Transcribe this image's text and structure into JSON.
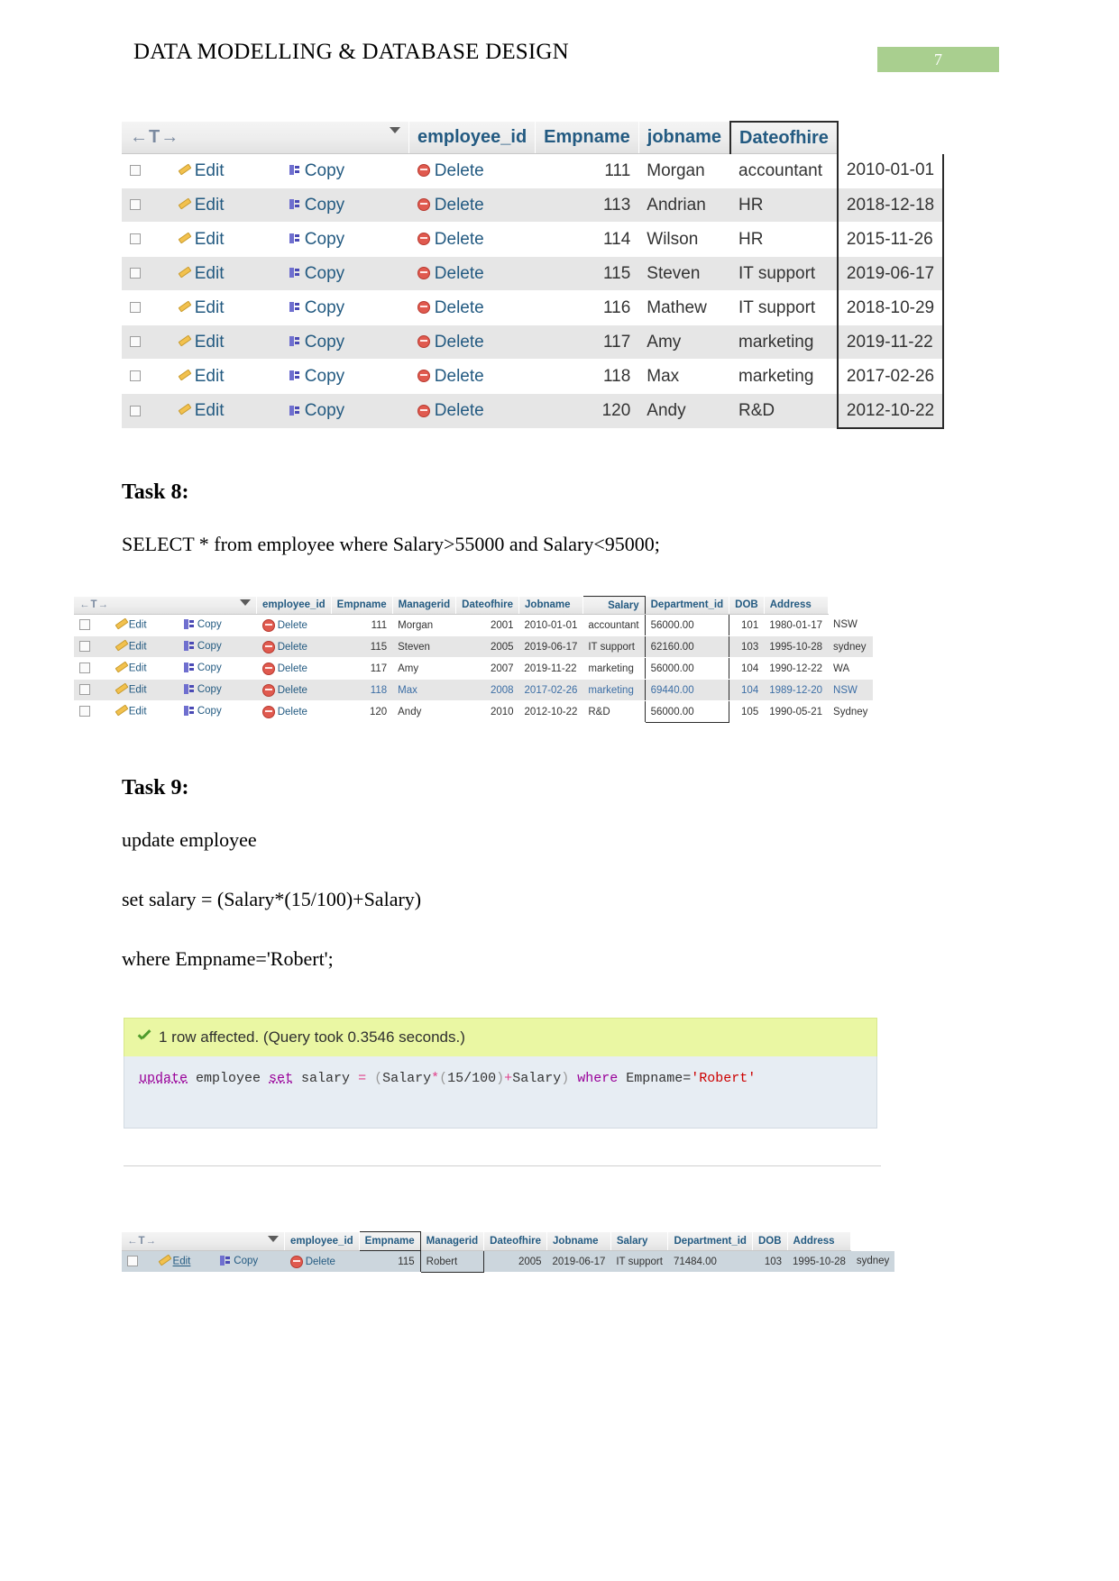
{
  "header": {
    "title": "DATA MODELLING & DATABASE DESIGN",
    "page_number": "7",
    "page_number_bg": "#a9cf8f"
  },
  "table1": {
    "nav_label": "←T→",
    "sort_icon": "chevron-down-icon",
    "columns": [
      "employee_id",
      "Empname",
      "jobname",
      "Dateofhire"
    ],
    "action_labels": {
      "edit": "Edit",
      "copy": "Copy",
      "delete": "Delete"
    },
    "rows": [
      {
        "employee_id": "111",
        "Empname": "Morgan",
        "jobname": "accountant",
        "Dateofhire": "2010-01-01"
      },
      {
        "employee_id": "113",
        "Empname": "Andrian",
        "jobname": "HR",
        "Dateofhire": "2018-12-18"
      },
      {
        "employee_id": "114",
        "Empname": "Wilson",
        "jobname": "HR",
        "Dateofhire": "2015-11-26"
      },
      {
        "employee_id": "115",
        "Empname": "Steven",
        "jobname": "IT support",
        "Dateofhire": "2019-06-17"
      },
      {
        "employee_id": "116",
        "Empname": "Mathew",
        "jobname": "IT support",
        "Dateofhire": "2018-10-29"
      },
      {
        "employee_id": "117",
        "Empname": "Amy",
        "jobname": "marketing",
        "Dateofhire": "2019-11-22"
      },
      {
        "employee_id": "118",
        "Empname": "Max",
        "jobname": "marketing",
        "Dateofhire": "2017-02-26"
      },
      {
        "employee_id": "120",
        "Empname": "Andy",
        "jobname": "R&D",
        "Dateofhire": "2012-10-22"
      }
    ]
  },
  "task8": {
    "heading": "Task 8:",
    "query": "SELECT * from employee where Salary>55000 and Salary<95000;",
    "table": {
      "nav_label": "←T→",
      "columns": [
        "employee_id",
        "Empname",
        "Managerid",
        "Dateofhire",
        "Jobname",
        "Salary",
        "Department_id",
        "DOB",
        "Address"
      ],
      "action_labels": {
        "edit": "Edit",
        "copy": "Copy",
        "delete": "Delete"
      },
      "rows": [
        {
          "employee_id": "111",
          "Empname": "Morgan",
          "Managerid": "2001",
          "Dateofhire": "2010-01-01",
          "Jobname": "accountant",
          "Salary": "56000.00",
          "Department_id": "101",
          "DOB": "1980-01-17",
          "Address": "NSW"
        },
        {
          "employee_id": "115",
          "Empname": "Steven",
          "Managerid": "2005",
          "Dateofhire": "2019-06-17",
          "Jobname": "IT support",
          "Salary": "62160.00",
          "Department_id": "103",
          "DOB": "1995-10-28",
          "Address": "sydney"
        },
        {
          "employee_id": "117",
          "Empname": "Amy",
          "Managerid": "2007",
          "Dateofhire": "2019-11-22",
          "Jobname": "marketing",
          "Salary": "56000.00",
          "Department_id": "104",
          "DOB": "1990-12-22",
          "Address": "WA"
        },
        {
          "employee_id": "118",
          "Empname": "Max",
          "Managerid": "2008",
          "Dateofhire": "2017-02-26",
          "Jobname": "marketing",
          "Salary": "69440.00",
          "Department_id": "104",
          "DOB": "1989-12-20",
          "Address": "NSW"
        },
        {
          "employee_id": "120",
          "Empname": "Andy",
          "Managerid": "2010",
          "Dateofhire": "2012-10-22",
          "Jobname": "R&D",
          "Salary": "56000.00",
          "Department_id": "105",
          "DOB": "1990-05-21",
          "Address": "Sydney"
        }
      ]
    }
  },
  "task9": {
    "heading": "Task 9:",
    "query_lines": [
      "update employee",
      "set salary = (Salary*(15/100)+Salary)",
      "where Empname='Robert';"
    ],
    "result_box": {
      "status_text": "1 row affected. (Query took 0.3546 seconds.)",
      "status_icon": "check-icon",
      "sql": {
        "kw_update": "update",
        "t_employee": " employee ",
        "kw_set": "set",
        "t_salary": " salary ",
        "op_eq": "=",
        "p_open": " (",
        "t_Salary": "Salary",
        "op_star": "*",
        "p_open2": "(",
        "n_15100": "15/100",
        "p_close": ")",
        "op_plus": "+",
        "t_Salary2": "Salary",
        "p_close2": ") ",
        "kw_where": "where",
        "t_empname": " Empname=",
        "str_robert": "'Robert'"
      }
    },
    "table": {
      "nav_label": "←T→",
      "columns": [
        "employee_id",
        "Empname",
        "Managerid",
        "Dateofhire",
        "Jobname",
        "Salary",
        "Department_id",
        "DOB",
        "Address"
      ],
      "action_labels": {
        "edit": "Edit",
        "copy": "Copy",
        "delete": "Delete"
      },
      "rows": [
        {
          "employee_id": "115",
          "Empname": "Robert",
          "Managerid": "2005",
          "Dateofhire": "2019-06-17",
          "Jobname": "IT support",
          "Salary": "71484.00",
          "Department_id": "103",
          "DOB": "1995-10-28",
          "Address": "sydney"
        }
      ]
    }
  }
}
